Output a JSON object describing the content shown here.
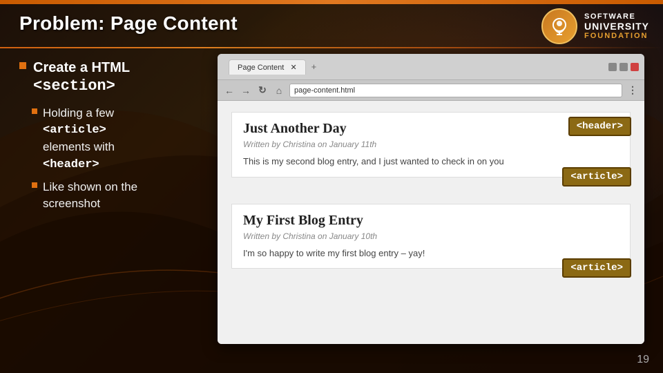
{
  "slide": {
    "title": "Problem: Page Content",
    "page_number": "19"
  },
  "logo": {
    "software": "SOFTWARE",
    "university": "UNIVERSITY",
    "foundation": "FOUNDATION"
  },
  "bullets": {
    "main_label": "Create a HTML",
    "main_tag": "<section>",
    "sub1_prefix": "Holding a few",
    "sub1_tag": "<article>",
    "sub1_suffix": "elements with",
    "sub1_tag2": "<header>",
    "sub2_prefix": "Like shown on the",
    "sub2_suffix": "screenshot"
  },
  "browser": {
    "tab_label": "Page Content",
    "address": "page-content.html",
    "article1": {
      "title": "Just Another Day",
      "meta": "Written by Christina on January 11th",
      "body": "This is my second blog entry, and I just wanted to check in on you"
    },
    "article2": {
      "title": "My First Blog Entry",
      "meta": "Written by Christina on January 10th",
      "body": "I'm so happy to write my first blog entry – yay!"
    }
  },
  "annotations": {
    "header_tag": "<header>",
    "article_tag1": "<article>",
    "article_tag2": "<article>"
  },
  "colors": {
    "accent": "#e07010",
    "annotation_bg": "#8B6914",
    "annotation_border": "#6B4A00"
  }
}
